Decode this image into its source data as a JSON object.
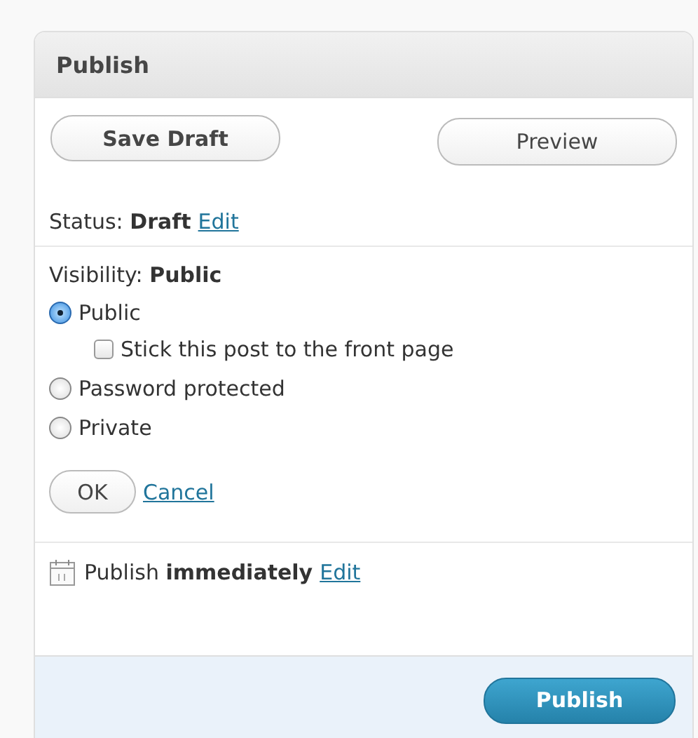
{
  "panel": {
    "title": "Publish"
  },
  "actions": {
    "save_draft": "Save Draft",
    "preview": "Preview"
  },
  "status": {
    "text": "Status: **Draft**",
    "edit": "Edit"
  },
  "visibility": {
    "text": "Visibility: **Public**",
    "options": [
      {
        "label": "Public",
        "selected": true,
        "sticky": {
          "label": "Stick this post to the front page",
          "checked": false
        }
      },
      {
        "label": "Password protected",
        "selected": false
      },
      {
        "label": "Private",
        "selected": false
      }
    ],
    "ok": "OK",
    "cancel": "Cancel"
  },
  "schedule": {
    "text": "Publish **immediately**",
    "edit": "Edit"
  },
  "publish_button": "Publish"
}
